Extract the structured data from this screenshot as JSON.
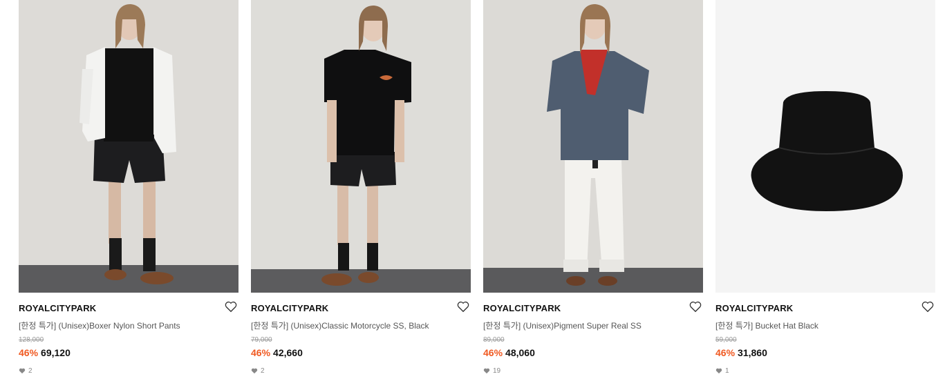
{
  "products": [
    {
      "brand": "ROYALCITYPARK",
      "name": "[한정 특가] (Unisex)Boxer Nylon Short Pants",
      "original_price": "128,000",
      "discount": "46%",
      "price": "69,120",
      "likes": "2",
      "image": "model-white-shirt-black-shorts"
    },
    {
      "brand": "ROYALCITYPARK",
      "name": "[한정 특가] (Unisex)Classic Motorcycle SS, Black",
      "original_price": "79,000",
      "discount": "46%",
      "price": "42,660",
      "likes": "2",
      "image": "model-black-tee-black-shorts"
    },
    {
      "brand": "ROYALCITYPARK",
      "name": "[한정 특가] (Unisex)Pigment Super Real SS",
      "original_price": "89,000",
      "discount": "46%",
      "price": "48,060",
      "likes": "19",
      "image": "model-navy-tee-white-pants"
    },
    {
      "brand": "ROYALCITYPARK",
      "name": "[한정 특가] Bucket Hat Black",
      "original_price": "59,000",
      "discount": "46%",
      "price": "31,860",
      "likes": "1",
      "image": "black-bucket-hat"
    }
  ],
  "colors": {
    "discount": "#f05a22",
    "wall": "#dcdad6",
    "floor": "#5a5a5c",
    "hat_bg": "#f4f4f4"
  },
  "icons": {
    "wishlist": "heart-outline-icon",
    "likes": "heart-filled-icon"
  }
}
